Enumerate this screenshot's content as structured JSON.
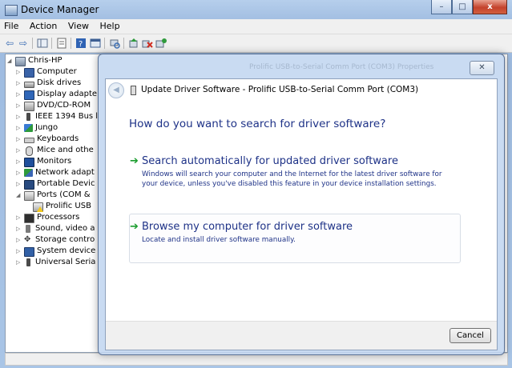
{
  "window": {
    "title": "Device Manager",
    "minimize": "–",
    "maximize": "□",
    "close": "x"
  },
  "menu": [
    "File",
    "Action",
    "View",
    "Help"
  ],
  "tree": {
    "root": "Chris-HP",
    "items": [
      {
        "label": "Computer",
        "icon": "computer-icon"
      },
      {
        "label": "Disk drives",
        "icon": "disk-drive-icon"
      },
      {
        "label": "Display adapte",
        "icon": "display-adapter-icon"
      },
      {
        "label": "DVD/CD-ROM",
        "icon": "dvd-drive-icon"
      },
      {
        "label": "IEEE 1394 Bus l",
        "icon": "ieee1394-icon"
      },
      {
        "label": "Jungo",
        "icon": "jungo-icon"
      },
      {
        "label": "Keyboards",
        "icon": "keyboard-icon"
      },
      {
        "label": "Mice and othe",
        "icon": "mouse-icon"
      },
      {
        "label": "Monitors",
        "icon": "monitor-icon"
      },
      {
        "label": "Network adapt",
        "icon": "network-adapter-icon"
      },
      {
        "label": "Portable Devic",
        "icon": "portable-device-icon"
      },
      {
        "label": "Ports (COM &",
        "icon": "port-icon"
      },
      {
        "label": "Prolific USB",
        "icon": "warning-device-icon"
      },
      {
        "label": "Processors",
        "icon": "processor-icon"
      },
      {
        "label": "Sound, video a",
        "icon": "sound-icon"
      },
      {
        "label": "Storage contro",
        "icon": "storage-controller-icon"
      },
      {
        "label": "System device",
        "icon": "system-device-icon"
      },
      {
        "label": "Universal Seria",
        "icon": "usb-controller-icon"
      }
    ]
  },
  "dialog": {
    "ghost_title": "Prolific USB-to-Serial Comm Port (COM3) Properties",
    "close": "✕",
    "back": "◀",
    "title": "Update Driver Software - Prolific USB-to-Serial Comm Port (COM3)",
    "question": "How do you want to search for driver software?",
    "option1": {
      "title": "Search automatically for updated driver software",
      "desc": "Windows will search your computer and the Internet for the latest driver software for your device, unless you've disabled this feature in your device installation settings."
    },
    "option2": {
      "title": "Browse my computer for driver software",
      "desc": "Locate and install driver software manually."
    },
    "cancel": "Cancel"
  },
  "colors": {
    "link_blue": "#1e3287",
    "arrow_green": "#1a9c2d"
  }
}
